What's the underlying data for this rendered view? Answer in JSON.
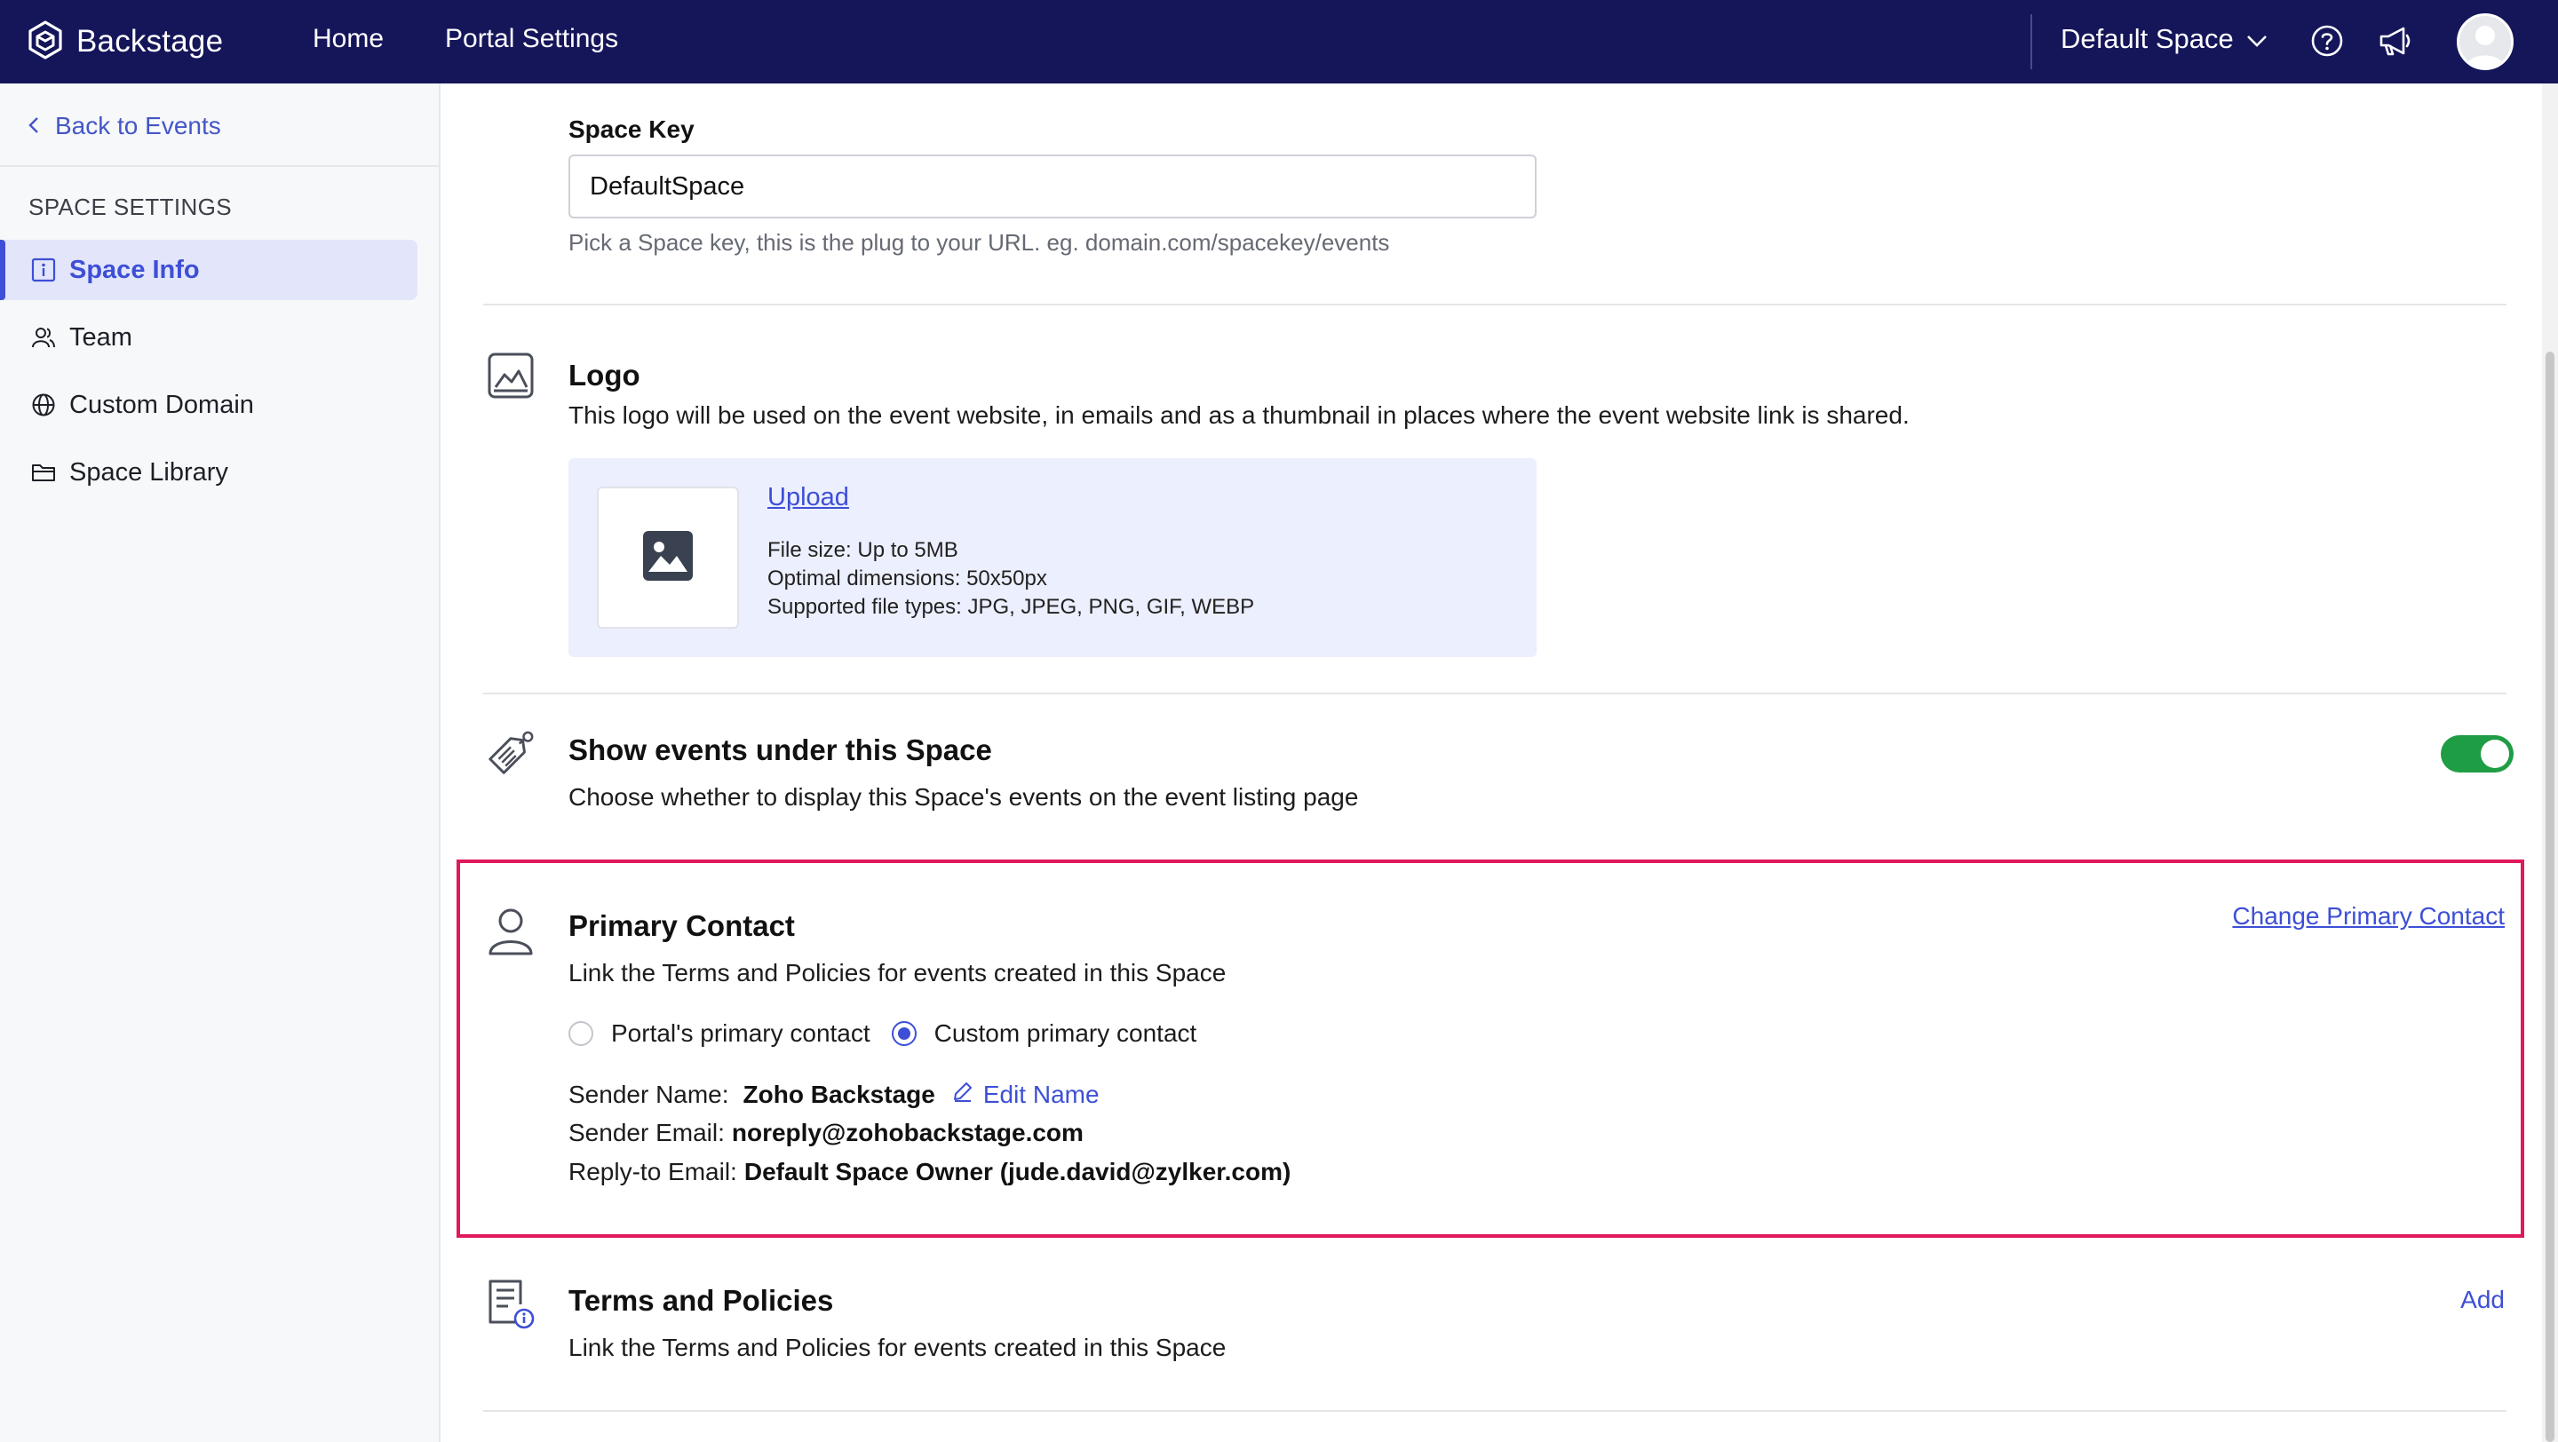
{
  "topbar": {
    "brand": "Backstage",
    "nav": [
      "Home",
      "Portal Settings"
    ],
    "space_selector": "Default Space",
    "icons": [
      "backstage-logo-icon",
      "chevron-down-icon",
      "help-icon",
      "megaphone-icon",
      "user-avatar"
    ]
  },
  "sidebar": {
    "back_label": "Back to Events",
    "heading": "SPACE SETTINGS",
    "items": [
      {
        "label": "Space Info",
        "icon": "info-icon",
        "active": true
      },
      {
        "label": "Team",
        "icon": "team-icon",
        "active": false
      },
      {
        "label": "Custom Domain",
        "icon": "globe-icon",
        "active": false
      },
      {
        "label": "Space Library",
        "icon": "folder-icon",
        "active": false
      }
    ]
  },
  "space_key": {
    "label": "Space Key",
    "value": "DefaultSpace",
    "hint": "Pick a Space key, this is the plug to your URL. eg. domain.com/spacekey/events"
  },
  "logo": {
    "title": "Logo",
    "description": "This logo will be used on the event website, in emails and as a thumbnail in places where the event website link is shared.",
    "upload_label": "Upload",
    "file_size": "File size: Up to 5MB",
    "dimensions": "Optimal dimensions: 50x50px",
    "file_types": "Supported file types: JPG, JPEG, PNG, GIF, WEBP"
  },
  "show_events": {
    "title": "Show events under this Space",
    "description": "Choose whether to display this Space's events on the event listing page",
    "enabled": true
  },
  "primary_contact": {
    "title": "Primary Contact",
    "description": "Link the Terms and Policies for events created in this Space",
    "change_link": "Change Primary Contact",
    "options": [
      {
        "label": "Portal's primary contact",
        "checked": false
      },
      {
        "label": "Custom primary contact",
        "checked": true
      }
    ],
    "sender_name_label": "Sender Name:",
    "sender_name": "Zoho Backstage",
    "edit_name": "Edit Name",
    "sender_email_label": "Sender Email:",
    "sender_email": "noreply@zohobackstage.com",
    "reply_to_label": "Reply-to Email:",
    "reply_to": "Default Space Owner (jude.david@zylker.com)"
  },
  "terms": {
    "title": "Terms and Policies",
    "description": "Link the Terms and Policies for events created in this Space",
    "add_label": "Add"
  },
  "colors": {
    "topbar": "#15155a",
    "accent": "#3d4fd6",
    "toggle_on": "#1f9d44",
    "highlight": "#e0185e"
  }
}
